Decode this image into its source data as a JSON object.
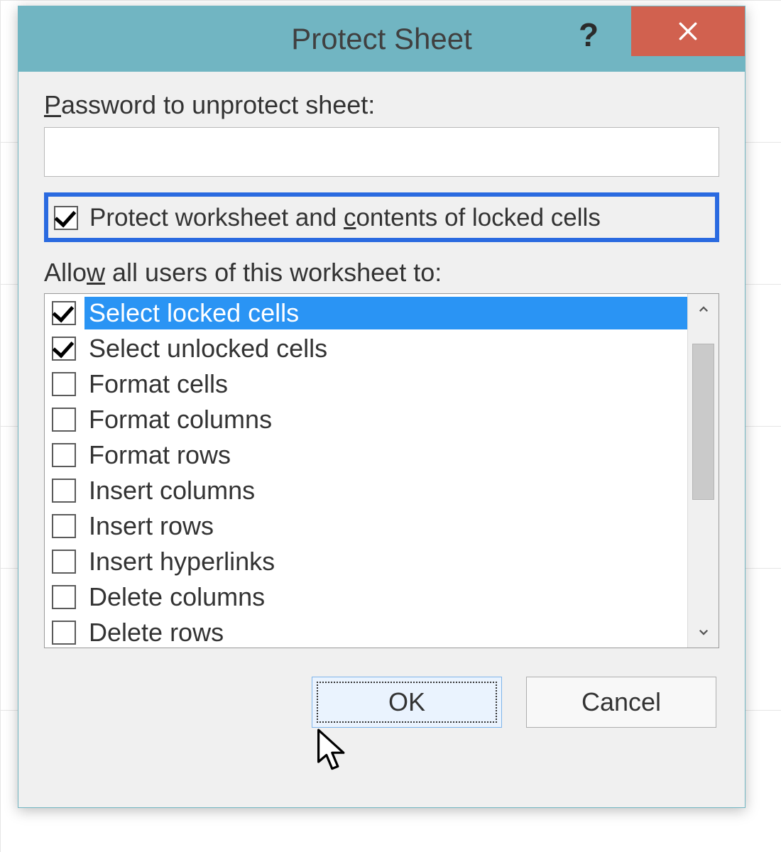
{
  "dialog": {
    "title": "Protect Sheet",
    "help_symbol": "?",
    "password_label_pre": "P",
    "password_label_post": "assword to unprotect sheet:",
    "password_value": "",
    "protect_checkbox": {
      "checked": true,
      "label_pre": "Protect worksheet and ",
      "label_u": "c",
      "label_post": "ontents of locked cells"
    },
    "allow_label_pre": "Allo",
    "allow_label_u": "w",
    "allow_label_post": " all users of this worksheet to:",
    "permissions": [
      {
        "label": "Select locked cells",
        "checked": true,
        "selected": true
      },
      {
        "label": "Select unlocked cells",
        "checked": true,
        "selected": false
      },
      {
        "label": "Format cells",
        "checked": false,
        "selected": false
      },
      {
        "label": "Format columns",
        "checked": false,
        "selected": false
      },
      {
        "label": "Format rows",
        "checked": false,
        "selected": false
      },
      {
        "label": "Insert columns",
        "checked": false,
        "selected": false
      },
      {
        "label": "Insert rows",
        "checked": false,
        "selected": false
      },
      {
        "label": "Insert hyperlinks",
        "checked": false,
        "selected": false
      },
      {
        "label": "Delete columns",
        "checked": false,
        "selected": false
      },
      {
        "label": "Delete rows",
        "checked": false,
        "selected": false
      }
    ],
    "buttons": {
      "ok": "OK",
      "cancel": "Cancel"
    }
  }
}
